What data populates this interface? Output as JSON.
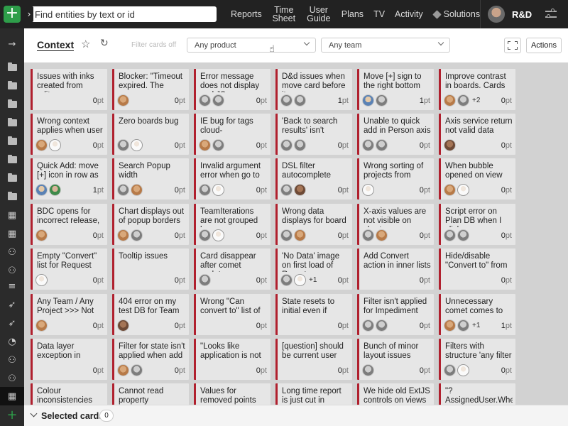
{
  "topbar": {
    "add_label": "+",
    "search_placeholder": "Find entities by text or id",
    "nav": [
      "Reports",
      "Time Sheet",
      "User Guide",
      "Plans",
      "TV",
      "Activity"
    ],
    "solutions_label": "Solutions",
    "user_name": "R&D"
  },
  "toolbar": {
    "title": "Context",
    "filter_label": "Filter cards off",
    "product_select": "Any product",
    "team_select": "Any team",
    "actions_label": "Actions"
  },
  "bottombar": {
    "selected_label": "Selected cards",
    "selected_count": "0"
  },
  "colors": {
    "accent_green": "#2e9e4a",
    "card_stripe": "#b0202e",
    "topbar_bg": "#222222"
  },
  "board": {
    "columns": [
      [
        {
          "title": "Issues with inks created from editor",
          "avatars": [],
          "more": "",
          "points": "0"
        },
        {
          "title": "Wrong context applies when user",
          "avatars": [
            "a1",
            "a5"
          ],
          "more": "",
          "points": "0"
        },
        {
          "title": "Quick Add: move [+] icon in row as",
          "avatars": [
            "a3",
            "a4"
          ],
          "more": "",
          "points": "1"
        },
        {
          "title": "BDC opens for incorrect release,",
          "avatars": [
            "a1"
          ],
          "more": "",
          "points": "0"
        },
        {
          "title": "Empty \"Convert\" list for Request",
          "avatars": [
            "a5"
          ],
          "more": "",
          "points": "0"
        },
        {
          "title": "Any Team / Any Project >>> Not",
          "avatars": [
            "a1"
          ],
          "more": "",
          "points": "0"
        },
        {
          "title": "Data layer exception in",
          "avatars": [],
          "more": "",
          "points": "0"
        },
        {
          "title": "Colour inconsistencies",
          "avatars": [],
          "more": "",
          "points": ""
        }
      ],
      [
        {
          "title": "Blocker: \"Timeout expired. The",
          "avatars": [
            "a1"
          ],
          "more": "",
          "points": "0"
        },
        {
          "title": "Zero boards bug",
          "avatars": [
            "a2",
            "a5"
          ],
          "more": "",
          "points": "0"
        },
        {
          "title": "Search Popup width",
          "avatars": [
            "a2",
            "a1"
          ],
          "more": "",
          "points": "0"
        },
        {
          "title": "Chart displays out of popup borders",
          "avatars": [
            "a1",
            "a2"
          ],
          "more": "",
          "points": "0"
        },
        {
          "title": "Tooltip issues",
          "avatars": [],
          "more": "",
          "points": "0"
        },
        {
          "title": "404 error on my test DB for Team",
          "avatars": [
            "a6"
          ],
          "more": "",
          "points": "0"
        },
        {
          "title": "Filter for state isn't applied when add",
          "avatars": [
            "a1",
            "a2"
          ],
          "more": "",
          "points": "0"
        },
        {
          "title": "Cannot read property",
          "avatars": [],
          "more": "",
          "points": ""
        }
      ],
      [
        {
          "title": "Error message does not display and JS",
          "avatars": [
            "a2",
            "a2"
          ],
          "more": "",
          "points": "0"
        },
        {
          "title": "IE bug for tags cloud-",
          "avatars": [
            "a1",
            "a2"
          ],
          "more": "",
          "points": "0"
        },
        {
          "title": "Invalid argument error when go to",
          "avatars": [
            "a2",
            "a5"
          ],
          "more": "",
          "points": "0"
        },
        {
          "title": "TeamIterations are not grouped by",
          "avatars": [
            "a2",
            "a5"
          ],
          "more": "",
          "points": "0"
        },
        {
          "title": "Card disappear after comet update",
          "avatars": [
            "a2"
          ],
          "more": "",
          "points": "0"
        },
        {
          "title": "Wrong \"Can convert to\" list of",
          "avatars": [],
          "more": "",
          "points": "0"
        },
        {
          "title": "\"Looks like application is not",
          "avatars": [],
          "more": "",
          "points": "0"
        },
        {
          "title": "Values for removed points are hidden",
          "avatars": [],
          "more": "",
          "points": ""
        }
      ],
      [
        {
          "title": "D&d issues when move card before it",
          "avatars": [
            "a2",
            "a2"
          ],
          "more": "",
          "points": "1"
        },
        {
          "title": "'Back to search results' isn't",
          "avatars": [
            "a2",
            "a2"
          ],
          "more": "",
          "points": "0"
        },
        {
          "title": "DSL filter autocomplete",
          "avatars": [
            "a2",
            "a6"
          ],
          "more": "",
          "points": "0"
        },
        {
          "title": "Wrong data displays for board",
          "avatars": [
            "a2",
            "a1"
          ],
          "more": "",
          "points": "0"
        },
        {
          "title": "'No Data' image on first load of Reports",
          "avatars": [
            "a2",
            "a5"
          ],
          "more": "+1",
          "points": "0"
        },
        {
          "title": "State resets to initial even if name",
          "avatars": [],
          "more": "",
          "points": "0"
        },
        {
          "title": "[question] should be current user",
          "avatars": [],
          "more": "",
          "points": "0"
        },
        {
          "title": "Long time report is just cut in popup.",
          "avatars": [],
          "more": "",
          "points": ""
        }
      ],
      [
        {
          "title": "Move [+] sign to the right bottom corner",
          "avatars": [
            "a3",
            "a2"
          ],
          "more": "",
          "points": "1"
        },
        {
          "title": "Unable to quick add in Person axis",
          "avatars": [
            "a2",
            "a2"
          ],
          "more": "",
          "points": "0"
        },
        {
          "title": "Wrong sorting of projects from",
          "avatars": [
            "a5"
          ],
          "more": "",
          "points": "0"
        },
        {
          "title": "X-axis values are not visible on chart",
          "avatars": [
            "a2",
            "a1"
          ],
          "more": "",
          "points": "0"
        },
        {
          "title": "Add Convert action in inner lists",
          "avatars": [],
          "more": "",
          "points": "0"
        },
        {
          "title": "Filter isn't applied for Impediment",
          "avatars": [
            "a2",
            "a2"
          ],
          "more": "",
          "points": "0"
        },
        {
          "title": "Bunch of minor layout issues",
          "avatars": [
            "a2"
          ],
          "more": "",
          "points": "0"
        },
        {
          "title": "We hide old ExtJS controls on views",
          "avatars": [],
          "more": "",
          "points": ""
        }
      ],
      [
        {
          "title": "Improve contrast in boards. Cards",
          "avatars": [
            "a1",
            "a2"
          ],
          "more": "+2",
          "points": "0"
        },
        {
          "title": "Axis service return not valid data",
          "avatars": [
            "a6"
          ],
          "more": "",
          "points": "0"
        },
        {
          "title": "When bubble opened on view",
          "avatars": [
            "a1",
            "a5"
          ],
          "more": "",
          "points": "0"
        },
        {
          "title": "Script error on Plan DB when I click on",
          "avatars": [
            "a2",
            "a2"
          ],
          "more": "",
          "points": "0"
        },
        {
          "title": "Hide/disable \"Convert to\" from",
          "avatars": [],
          "more": "",
          "points": "0"
        },
        {
          "title": "Unnecessary comet comes to user",
          "avatars": [
            "a1",
            "a2"
          ],
          "more": "+1",
          "points": "1"
        },
        {
          "title": "Filters with structure 'any filter",
          "avatars": [
            "a2",
            "a5"
          ],
          "more": "",
          "points": "0"
        },
        {
          "title": "\"? AssignedUser.Where",
          "avatars": [],
          "more": "",
          "points": ""
        }
      ]
    ]
  }
}
